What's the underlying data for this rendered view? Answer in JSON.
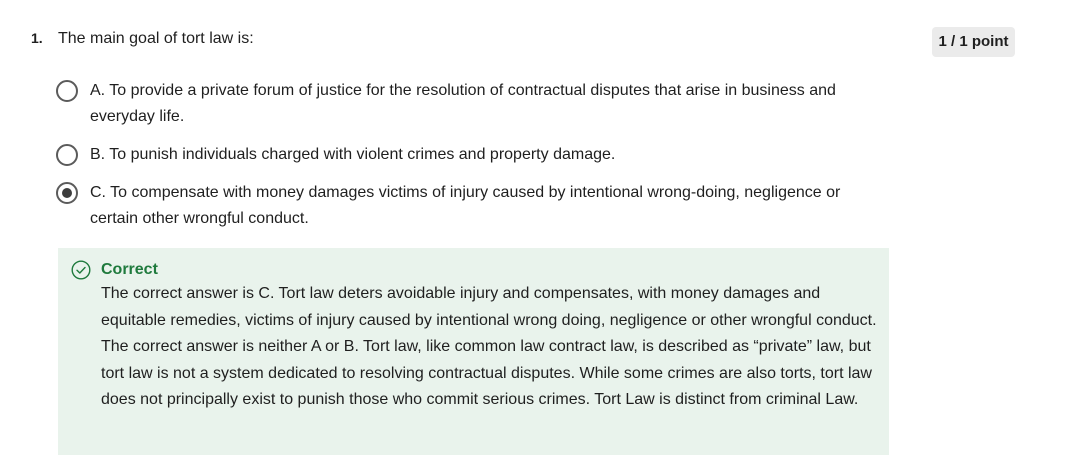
{
  "question": {
    "number": "1.",
    "text": "The main goal of tort law is:",
    "points": "1 / 1 point"
  },
  "options": [
    {
      "label": "A. To provide a private forum of justice for the resolution of contractual disputes that arise in business and everyday life.",
      "selected": false
    },
    {
      "label": "B. To punish individuals charged with violent crimes and property damage.",
      "selected": false
    },
    {
      "label": "C. To compensate with money damages victims of injury caused by intentional wrong-doing, negligence or certain other wrongful conduct.",
      "selected": true
    }
  ],
  "feedback": {
    "icon": "check-circle-icon",
    "title": "Correct",
    "body": "The correct answer is C.   Tort law deters avoidable injury and compensates, with money damages and equitable remedies, victims of injury caused by intentional wrong doing, negligence or other wrongful conduct. The correct answer is neither A or B.  Tort law, like common law contract law, is described as “private” law, but tort law is not a system dedicated to resolving contractual disputes.  While some crimes are also torts, tort law does not principally exist to punish those who commit serious crimes.  Tort Law is distinct from criminal Law."
  },
  "colors": {
    "feedback_bg": "#e9f3ec",
    "correct_green": "#1f7a3d",
    "points_bg": "#ebebeb"
  }
}
